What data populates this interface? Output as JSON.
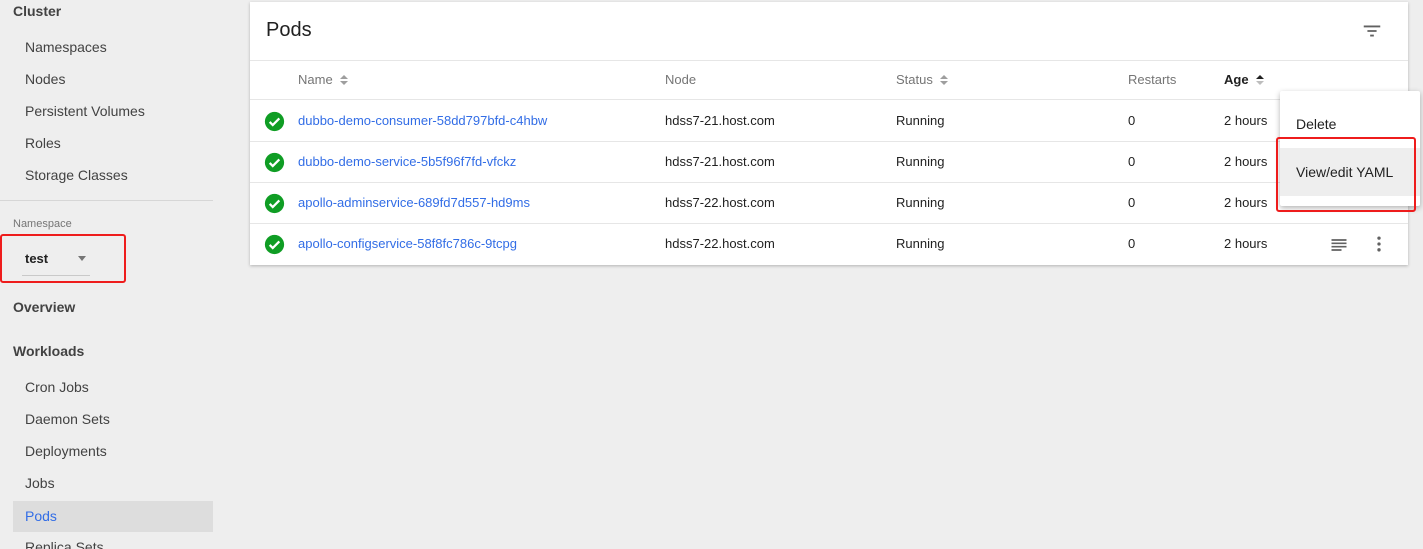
{
  "sidebar": {
    "cluster_heading": "Cluster",
    "cluster_items": [
      {
        "label": "Namespaces"
      },
      {
        "label": "Nodes"
      },
      {
        "label": "Persistent Volumes"
      },
      {
        "label": "Roles"
      },
      {
        "label": "Storage Classes"
      }
    ],
    "namespace_label": "Namespace",
    "namespace_value": "test",
    "overview": "Overview",
    "workloads_heading": "Workloads",
    "workload_items": [
      {
        "label": "Cron Jobs"
      },
      {
        "label": "Daemon Sets"
      },
      {
        "label": "Deployments"
      },
      {
        "label": "Jobs"
      },
      {
        "label": "Pods",
        "active": true
      },
      {
        "label": "Replica Sets"
      }
    ]
  },
  "pods": {
    "title": "Pods",
    "filter_icon": "filter-list-icon",
    "columns": {
      "name": "Name",
      "node": "Node",
      "status": "Status",
      "restarts": "Restarts",
      "age": "Age"
    },
    "sorted_column": "age",
    "rows": [
      {
        "name": "dubbo-demo-consumer-58dd797bfd-c4hbw",
        "node": "hdss7-21.host.com",
        "status": "Running",
        "restarts": "0",
        "age": "2 hours"
      },
      {
        "name": "dubbo-demo-service-5b5f96f7fd-vfckz",
        "node": "hdss7-21.host.com",
        "status": "Running",
        "restarts": "0",
        "age": "2 hours"
      },
      {
        "name": "apollo-adminservice-689fd7d557-hd9ms",
        "node": "hdss7-22.host.com",
        "status": "Running",
        "restarts": "0",
        "age": "2 hours"
      },
      {
        "name": "apollo-configservice-58f8fc786c-9tcpg",
        "node": "hdss7-22.host.com",
        "status": "Running",
        "restarts": "0",
        "age": "2 hours"
      }
    ]
  },
  "context_menu": {
    "items": [
      {
        "label": "Delete"
      },
      {
        "label": "View/edit YAML",
        "hovered": true
      }
    ]
  },
  "colors": {
    "accent": "#326de6",
    "running": "#0f9d24",
    "annotation_red": "#ee1c1c",
    "background": "#eeeeee"
  }
}
